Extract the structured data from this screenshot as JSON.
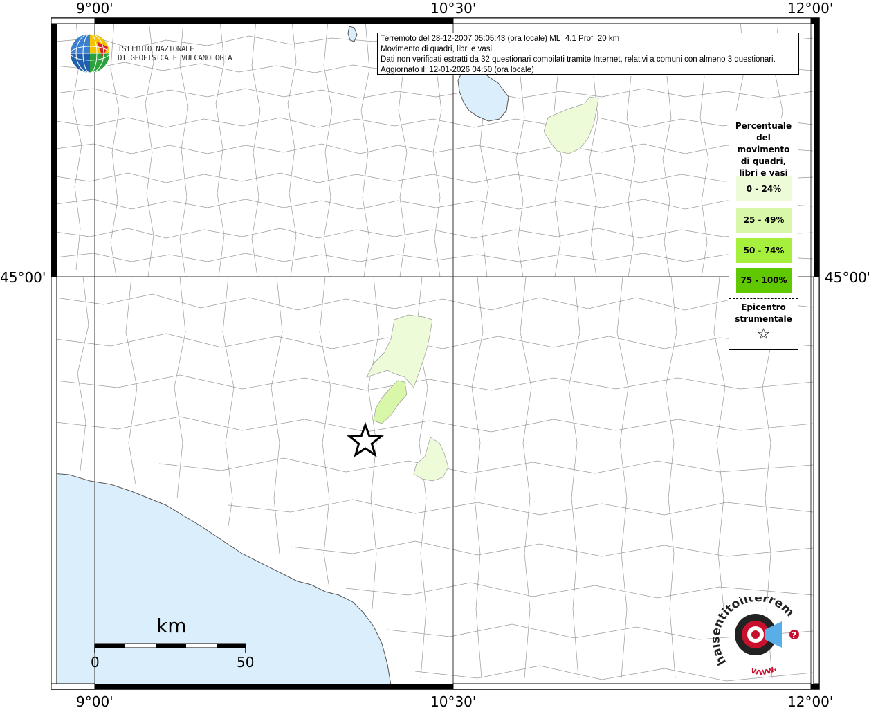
{
  "map": {
    "lon_ticks": [
      "9°00'",
      "10°30'",
      "12°00'"
    ],
    "lat_ticks": [
      "45°00'",
      "45°00'"
    ],
    "colors": {
      "sea": "#dbeefb",
      "land": "#ffffff",
      "border": "#9a9a9a",
      "class_0_24": "#eefbd9",
      "class_25_49": "#d9f7a8",
      "class_50_74": "#a6ef3c",
      "class_75_100": "#5fc800"
    }
  },
  "logo": {
    "line1": "ISTITUTO NAZIONALE",
    "line2": "DI GEOFISICA E VULCANOLOGIA"
  },
  "info": {
    "line1": "Terremoto del 28-12-2007 05:05:43 (ora locale) ML=4.1 Prof=20 km",
    "line2": "Movimento di quadri, libri e vasi",
    "line3": "Dati non verificati estratti da 32 questionari compilati tramite Internet, relativi a comuni con almeno 3 questionari.",
    "line4": "Aggiornato il: 12-01-2026 04:50 (ora locale)"
  },
  "legend": {
    "title_lines": [
      "Percentuale",
      "del",
      "movimento",
      "di quadri,",
      "libri e vasi"
    ],
    "items": [
      {
        "label": "0 - 24%",
        "color": "#eefbd9"
      },
      {
        "label": "25 - 49%",
        "color": "#d9f7a8"
      },
      {
        "label": "50 - 74%",
        "color": "#a6ef3c"
      },
      {
        "label": "75 - 100%",
        "color": "#5fc800"
      }
    ],
    "epicenter_lines": [
      "Epicentro",
      "strumentale"
    ],
    "epicenter_symbol": "☆"
  },
  "scale": {
    "unit": "km",
    "start": "0",
    "end": "50"
  },
  "watermark": {
    "text": "haisentitoilterremoto.it",
    "www": "www.",
    "question": "?"
  }
}
